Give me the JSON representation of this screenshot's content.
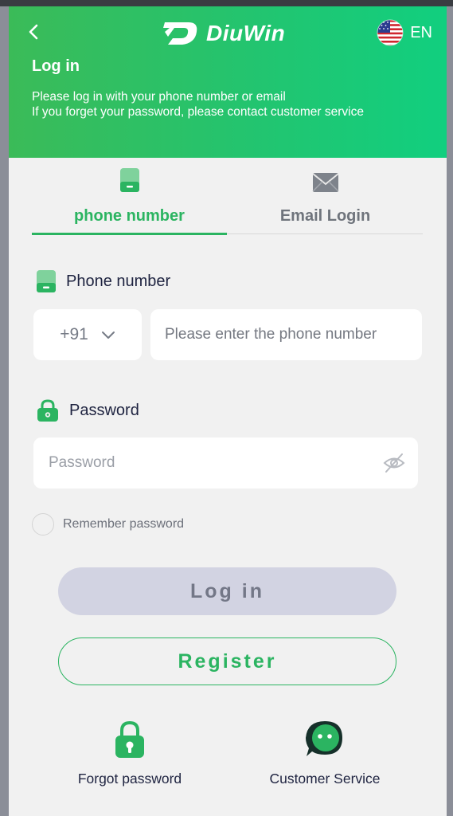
{
  "header": {
    "brand": "DiuWin",
    "language": "EN",
    "title": "Log in",
    "description_line1": "Please log in with your phone number or email",
    "description_line2": "If you forget your password, please contact customer service"
  },
  "tabs": [
    {
      "label": "phone number",
      "active": true,
      "icon": "phone-icon"
    },
    {
      "label": "Email Login",
      "active": false,
      "icon": "mail-icon"
    }
  ],
  "phone": {
    "label": "Phone number",
    "country_code": "+91",
    "placeholder": "Please enter the phone number"
  },
  "password": {
    "label": "Password",
    "placeholder": "Password"
  },
  "remember_label": "Remember password",
  "buttons": {
    "login": "Log in",
    "register": "Register"
  },
  "footer": {
    "forgot": "Forgot password",
    "service": "Customer Service"
  },
  "colors": {
    "brand_green": "#2bb461",
    "header_gradient_start": "#3bbb58",
    "header_gradient_end": "#11cf7f",
    "login_button_bg": "#d2d3e2",
    "page_bg": "#f1f1f1"
  }
}
